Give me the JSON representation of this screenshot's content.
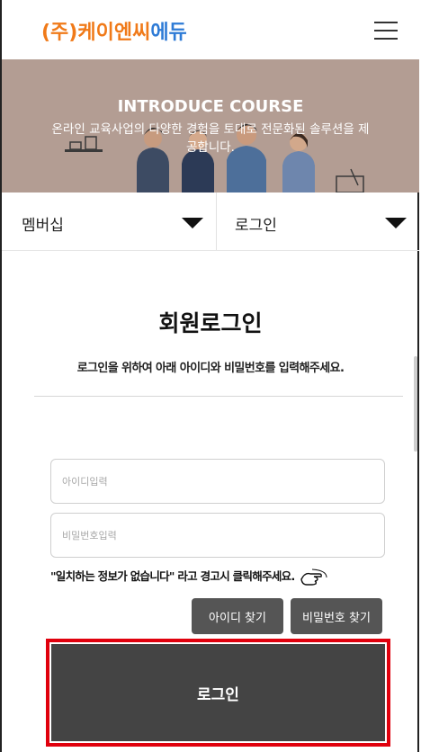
{
  "header": {
    "logo_part1": "(주)케이엔씨",
    "logo_part2": "에듀",
    "menu_icon": "hamburger-menu-icon"
  },
  "banner": {
    "title": "INTRODUCE COURSE",
    "subtitle": "온라인 교육사업의 다양한 경험을 토대로 전문화된 솔루션을 제공합니다."
  },
  "nav": {
    "dropdown1": "멤버십",
    "dropdown2": "로그인"
  },
  "page": {
    "title": "회원로그인",
    "description": "로그인을 위하여 아래 아이디와 비밀번호를 입력해주세요."
  },
  "form": {
    "id_placeholder": "아이디입력",
    "pw_placeholder": "비밀번호입력",
    "warning": "\"일치하는 정보가 없습니다\" 라고 경고시 클릭해주세요.",
    "find_id": "아이디 찾기",
    "find_pw": "비밀번호 찾기",
    "login": "로그인"
  },
  "colors": {
    "logo_orange": "#f07a19",
    "logo_blue": "#2e7bd6",
    "banner_bg": "#b39d93",
    "button_dark": "#444444",
    "highlight_red": "#e0000d"
  }
}
